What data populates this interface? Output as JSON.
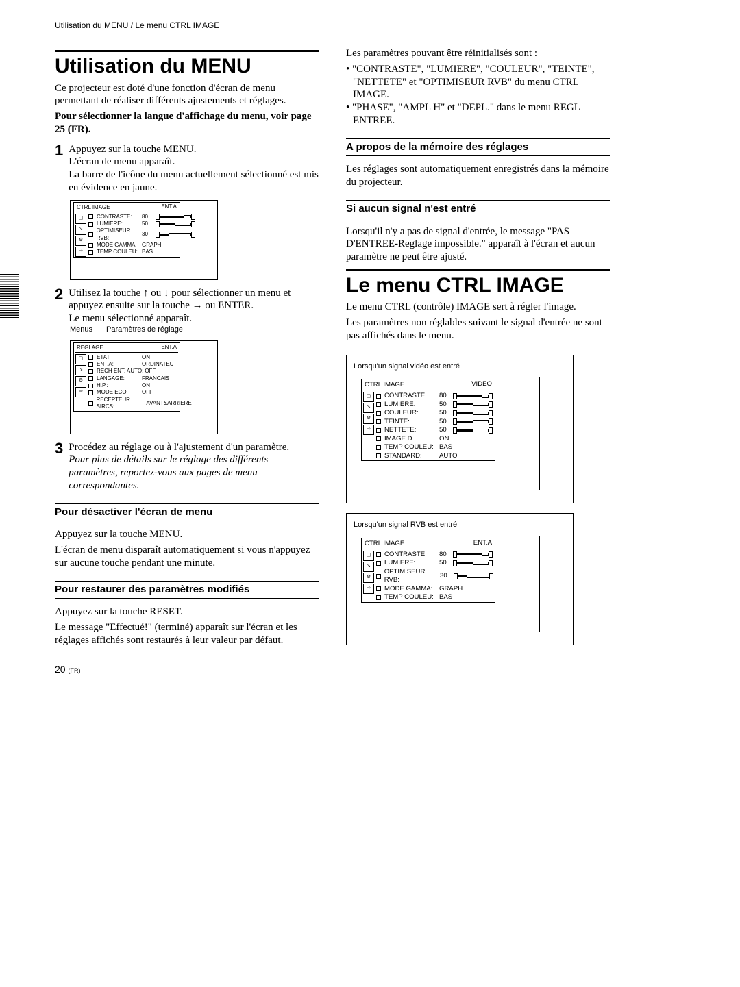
{
  "header": "Utilisation du MENU / Le menu CTRL IMAGE",
  "left": {
    "h1": "Utilisation du MENU",
    "intro": "Ce projecteur est doté d'une fonction d'écran de menu permettant de réaliser différents ajustements et réglages.",
    "lang_note": "Pour sélectionner la langue d'affichage du menu, voir page 25 (FR).",
    "step1": {
      "num": "1",
      "l1": "Appuyez sur la touche MENU.",
      "l2": "L'écran de menu apparaît.",
      "l3": "La barre de l'icône du menu actuellement sélectionné est mis en évidence en jaune."
    },
    "osd1": {
      "title": "CTRL IMAGE",
      "right": "ENT.A",
      "rows": [
        {
          "k": "CONTRASTE:",
          "v": "80",
          "slider": true,
          "fill": 0.8
        },
        {
          "k": "LUMIERE:",
          "v": "50",
          "slider": true,
          "fill": 0.5
        },
        {
          "k": "OPTIMISEUR RVB:",
          "v": "30",
          "slider": true,
          "fill": 0.3
        },
        {
          "k": "MODE GAMMA:",
          "v": "GRAPH"
        },
        {
          "k": "TEMP COULEU:",
          "v": "BAS"
        }
      ]
    },
    "step2": {
      "num": "2",
      "l1a": "Utilisez la touche ",
      "l1b": " ou ",
      "l1c": " pour sélectionner un menu et appuyez ensuite sur la touche ",
      "l1d": " ou ENTER.",
      "l2": "Le menu sélectionné apparaît."
    },
    "osd2_labels": {
      "menus": "Menus",
      "params": "Paramètres de réglage"
    },
    "osd2": {
      "title": "REGLAGE",
      "right": "ENT.A",
      "rows": [
        {
          "k": "ETAT:",
          "v": "ON"
        },
        {
          "k": "ENT.A:",
          "v": "ORDINATEU"
        },
        {
          "k": "RECH ENT. AUTO:",
          "v": "OFF"
        },
        {
          "k": "LANGAGE:",
          "v": "FRANCAIS"
        },
        {
          "k": "H.P.:",
          "v": "ON"
        },
        {
          "k": "MODE ECO:",
          "v": "OFF"
        },
        {
          "k": "RECEPTEUR SIRCS:",
          "v": "AVANT&ARRIERE"
        }
      ]
    },
    "step3": {
      "num": "3",
      "l1": "Procédez au réglage ou à l'ajustement d'un paramètre.",
      "it": "Pour plus de détails sur le réglage des différents paramètres, reportez-vous aux pages de menu correspondantes."
    },
    "sec_deact_h": "Pour désactiver l'écran de menu",
    "sec_deact_p1": "Appuyez sur la touche MENU.",
    "sec_deact_p2": "L'écran de menu disparaît automatiquement si vous n'appuyez sur aucune touche pendant une minute.",
    "sec_rest_h": "Pour restaurer des paramètres modifiés",
    "sec_rest_p1": "Appuyez sur la touche RESET.",
    "sec_rest_p2": "Le message \"Effectué!\" (terminé) apparaît sur l'écran et les réglages affichés sont restaurés à leur valeur par défaut."
  },
  "right": {
    "p1": "Les paramètres pouvant être réinitialisés sont :",
    "b1": "\"CONTRASTE\", \"LUMIERE\", \"COULEUR\", \"TEINTE\", \"NETTETE\" et \"OPTIMISEUR RVB\" du menu CTRL IMAGE.",
    "b2": "\"PHASE\", \"AMPL H\" et \"DEPL.\" dans le menu REGL ENTREE.",
    "sec_mem_h": "A propos de la mémoire des réglages",
    "sec_mem_p": "Les réglages sont automatiquement enregistrés dans la mémoire du projecteur.",
    "sec_nosig_h": "Si aucun signal n'est entré",
    "sec_nosig_p": "Lorsqu'il n'y a pas de signal d'entrée, le message \"PAS D'ENTREE-Reglage impossible.\" apparaît à l'écran et aucun paramètre ne peut être ajusté.",
    "h1": "Le menu CTRL IMAGE",
    "p2": "Le menu CTRL (contrôle) IMAGE sert à régler l'image.",
    "p3": "Les paramètres non réglables suivant le signal d'entrée ne sont pas affichés dans le menu.",
    "cap_video": "Lorsqu'un signal vidéo est entré",
    "osd_video": {
      "title": "CTRL IMAGE",
      "right": "VIDEO",
      "rows": [
        {
          "k": "CONTRASTE:",
          "v": "80",
          "slider": true,
          "fill": 0.8
        },
        {
          "k": "LUMIERE:",
          "v": "50",
          "slider": true,
          "fill": 0.5
        },
        {
          "k": "COULEUR:",
          "v": "50",
          "slider": true,
          "fill": 0.5
        },
        {
          "k": "TEINTE:",
          "v": "50",
          "slider": true,
          "fill": 0.5
        },
        {
          "k": "NETTETE:",
          "v": "50",
          "slider": true,
          "fill": 0.5
        },
        {
          "k": "IMAGE D.:",
          "v": "ON"
        },
        {
          "k": "TEMP COULEU:",
          "v": "BAS"
        },
        {
          "k": "STANDARD:",
          "v": "AUTO"
        }
      ]
    },
    "cap_rgb": "Lorsqu'un signal RVB est entré",
    "osd_rgb": {
      "title": "CTRL IMAGE",
      "right": "ENT.A",
      "rows": [
        {
          "k": "CONTRASTE:",
          "v": "80",
          "slider": true,
          "fill": 0.8
        },
        {
          "k": "LUMIERE:",
          "v": "50",
          "slider": true,
          "fill": 0.5
        },
        {
          "k": "OPTIMISEUR RVB:",
          "v": "30",
          "slider": true,
          "fill": 0.3
        },
        {
          "k": "MODE GAMMA:",
          "v": "GRAPH"
        },
        {
          "k": "TEMP COULEU:",
          "v": "BAS"
        }
      ]
    }
  },
  "page": {
    "num": "20",
    "suffix": "(FR)"
  }
}
